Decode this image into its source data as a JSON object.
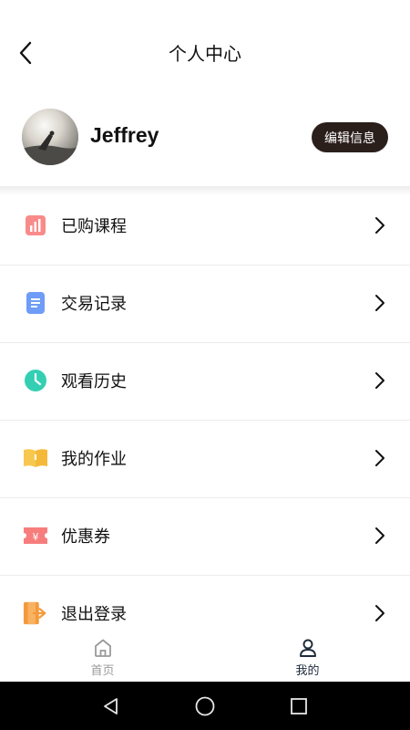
{
  "header": {
    "title": "个人中心"
  },
  "profile": {
    "name": "Jeffrey",
    "edit_label": "编辑信息"
  },
  "menu": {
    "items": [
      {
        "label": "已购课程",
        "icon": "purchased-courses-icon",
        "color": "#f06c6c"
      },
      {
        "label": "交易记录",
        "icon": "transaction-records-icon",
        "color": "#5b8ff5"
      },
      {
        "label": "观看历史",
        "icon": "clock-icon",
        "color": "#2ccdb0"
      },
      {
        "label": "我的作业",
        "icon": "book-icon",
        "color": "#f7c64a"
      },
      {
        "label": "优惠券",
        "icon": "coupon-icon",
        "color": "#f06a6a"
      },
      {
        "label": "退出登录",
        "icon": "logout-icon",
        "color": "#f29a3a"
      }
    ]
  },
  "tabbar": {
    "tabs": [
      {
        "label": "首页",
        "icon": "home-icon",
        "active": false
      },
      {
        "label": "我的",
        "icon": "user-icon",
        "active": true
      }
    ]
  },
  "colors": {
    "accent_dark": "#2b1f1c",
    "tab_active": "#1d2b3a",
    "tab_inactive": "#9a9a9a"
  }
}
